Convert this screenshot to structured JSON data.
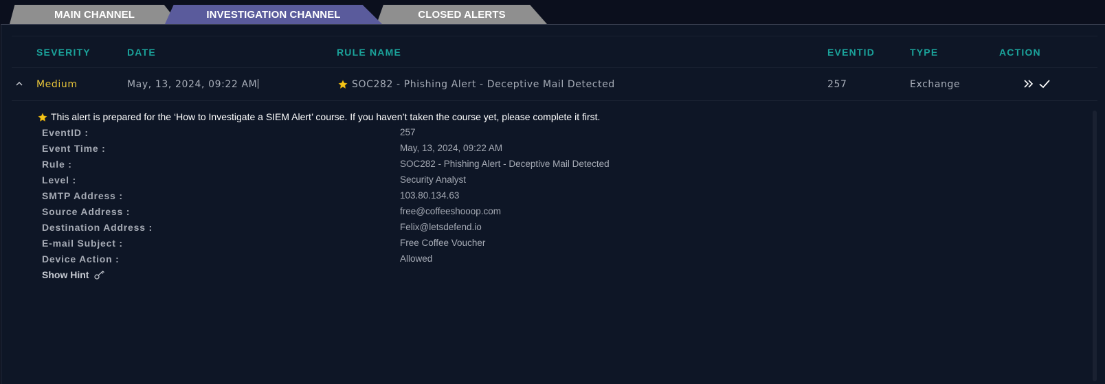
{
  "tabs": [
    {
      "label": "MAIN CHANNEL"
    },
    {
      "label": "INVESTIGATION CHANNEL"
    },
    {
      "label": "CLOSED ALERTS"
    }
  ],
  "columns": {
    "severity": "SEVERITY",
    "date": "DATE",
    "rule_name": "RULE NAME",
    "eventid": "EVENTID",
    "type": "TYPE",
    "action": "ACTION"
  },
  "alert": {
    "severity": "Medium",
    "date": "May, 13, 2024, 09:22 AM",
    "rule_name": "SOC282 - Phishing Alert - Deceptive Mail Detected",
    "eventid": "257",
    "type": "Exchange"
  },
  "details": {
    "notice": "This alert is prepared for the ‘How to Investigate a SIEM Alert’ course. If you haven’t taken the course yet, please complete it first.",
    "fields": [
      {
        "label": "EventID :",
        "value": "257"
      },
      {
        "label": "Event Time :",
        "value": "May, 13, 2024, 09:22 AM"
      },
      {
        "label": "Rule :",
        "value": "SOC282 - Phishing Alert - Deceptive Mail Detected"
      },
      {
        "label": "Level :",
        "value": "Security Analyst"
      },
      {
        "label": "SMTP Address :",
        "value": "103.80.134.63"
      },
      {
        "label": "Source Address :",
        "value": "free@coffeeshooop.com"
      },
      {
        "label": "Destination Address :",
        "value": "Felix@letsdefend.io"
      },
      {
        "label": "E-mail Subject :",
        "value": "Free Coffee Voucher"
      },
      {
        "label": "Device Action :",
        "value": "Allowed"
      }
    ],
    "hint_label": "Show Hint"
  },
  "colors": {
    "background": "#0b0f1d",
    "panel": "#0e1626",
    "header_teal": "#1ba39b",
    "severity_medium": "#e8c53a",
    "tab_active": "#5a5b9c",
    "tab_inactive": "#8f8f8f"
  },
  "icons": {
    "collapse": "chevron-up-icon",
    "star": "star-icon",
    "escalate": "double-chevron-right-icon",
    "close": "check-icon",
    "hint": "key-icon"
  }
}
